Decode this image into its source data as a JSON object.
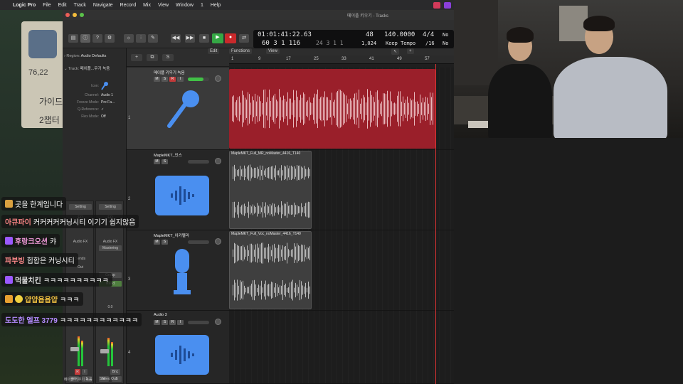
{
  "menubar": {
    "app": "Logic Pro",
    "items": [
      "File",
      "Edit",
      "Track",
      "Navigate",
      "Record",
      "Mix",
      "View",
      "Window",
      "1",
      "Help"
    ]
  },
  "window": {
    "title": "메이플 키우기 - Tracks"
  },
  "lcd": {
    "time": "01:01:41:22.63",
    "position": "60  3  1  116",
    "bar": "48",
    "division": "1,024",
    "tempo": "140.0000",
    "tempo_mode": "Keep Tempo",
    "signature": "4/4",
    "sig_div": "/16",
    "key_top": "No",
    "key_bottom": "No",
    "bar_small": "24  3  1  1"
  },
  "inspector": {
    "region_label": "Region:",
    "region_value": "Audio Defaults",
    "track_label": "Track:",
    "track_value": "메이플...우기 녹음",
    "icon_label": "Icon:",
    "fields": [
      {
        "label": "Channel:",
        "value": "Audio 1"
      },
      {
        "label": "Freeze Mode:",
        "value": "Pre Fa..."
      },
      {
        "label": "Q-Reference:",
        "value": "✓"
      },
      {
        "label": "Flex Mode:",
        "value": "Off"
      }
    ],
    "strip1": {
      "setting": "Setting",
      "eq": "EQ",
      "fx": "Audio FX",
      "sends": "Sends",
      "out": "Out",
      "rec": "R",
      "i": "I",
      "m": "M",
      "s": "S",
      "name": "메이플 키우기 녹음"
    },
    "strip2": {
      "setting": "Setting",
      "eq": "EQ",
      "fx": "Audio FX",
      "mastering": "Mastering",
      "group": "Group",
      "read": "Read",
      "value": "0.0",
      "bnc": "Bnc",
      "m": "M",
      "s": "S",
      "name": "Stereo Out"
    }
  },
  "track_toolbar": {
    "add": "+",
    "copy": "⧉",
    "s": "S"
  },
  "arrange_menus": {
    "edit": "Edit",
    "functions": "Functions",
    "view": "View"
  },
  "ruler": [
    "1",
    "9",
    "17",
    "25",
    "33",
    "41",
    "49",
    "57"
  ],
  "tracks": [
    {
      "num": "1",
      "name": "메이플 키우기 녹음",
      "m": "M",
      "s": "S",
      "r": "R",
      "i": "I",
      "icon": "microphone-icon"
    },
    {
      "num": "2",
      "name": "MapleMKT_인스",
      "m": "M",
      "s": "S",
      "icon": "waveform-icon"
    },
    {
      "num": "3",
      "name": "MapleMKT_아카펠라",
      "m": "M",
      "s": "S",
      "icon": "condenser-mic-icon"
    },
    {
      "num": "4",
      "name": "Audio 3",
      "m": "M",
      "s": "S",
      "r": "R",
      "i": "I",
      "icon": "waveform-icon"
    }
  ],
  "regions": [
    {
      "name": "",
      "color": "#9a1f2a"
    },
    {
      "name": "MapleMKT_Full_MR_noMaster_4416_T140",
      "color": "#3f3f3f"
    },
    {
      "name": "MapleMKT_Full_Voc_noMaster_4416_T140",
      "color": "#3f3f3f"
    }
  ],
  "chat": [
    {
      "nick": "",
      "text": "곳을 한계입니다"
    },
    {
      "nick": "아큐파이",
      "text": "커커커커커닝시티 이기기 쉽지않음",
      "color": "#f08080"
    },
    {
      "nick": "후랑크오션",
      "text": "캬",
      "color": "#f09ad9",
      "badge": "#9b59ff"
    },
    {
      "nick": "파부빙",
      "text": "힙합은 커닝시티",
      "color": "#ff8a8a"
    },
    {
      "nick": "먹물치킨",
      "text": "ㅋㅋㅋㅋㅋㅋㅋㅋㅋㅋ",
      "color": "#d9d9d9",
      "badge": "#9b59ff"
    },
    {
      "nick": "얍얍욥욥얍",
      "text": "ㅋㅋㅋ",
      "color": "#f0c040",
      "badge": "#e8a030"
    },
    {
      "nick": "도도한 엘프 3779",
      "text": "ㅋㅋㅋㅋㅋㅋㅋㅋㅋㅋㅋㅋ",
      "color": "#b48cff"
    }
  ],
  "game": {
    "stat": "76,22",
    "line1": "가이드",
    "line2": "2챕터"
  }
}
